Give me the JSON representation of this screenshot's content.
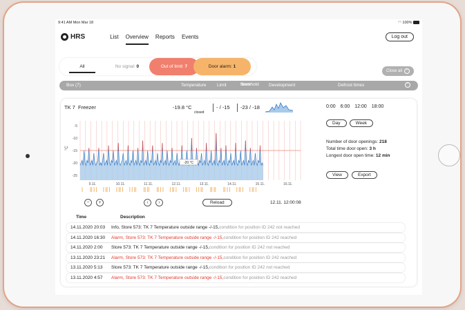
{
  "status_bar": {
    "time": "9:41 AM  Mon Mar 18",
    "battery": "100%"
  },
  "nav": {
    "logo": "HRS",
    "links": [
      "List",
      "Overview",
      "Reports",
      "Events"
    ],
    "active": "Overview",
    "logout": "Log out"
  },
  "filters": {
    "all": "All",
    "no_signal_label": "No signal:",
    "no_signal_count": "0",
    "out_of_limit_label": "Out of limit:",
    "out_of_limit_count": "7",
    "door_alarm_label": "Door alarm:",
    "door_alarm_count": "1"
  },
  "close_all": "Close all",
  "table_header": {
    "box": "Box  (7)",
    "temperature": "Temperature",
    "limit": "Limit",
    "norm1": "Norm",
    "norm2": "threshold",
    "development": "Development",
    "defrost": "Defrost times"
  },
  "card": {
    "id": "TK 7",
    "name": "Freezer",
    "temperature": "-19.8 °C",
    "door_state": "closed",
    "limit": "- / -15",
    "norm": "-23 / -18",
    "defrost_times": [
      "0:00",
      "6:00",
      "12:00",
      "18:00"
    ],
    "day_btn": "Day",
    "week_btn": "Week",
    "stats": [
      {
        "label": "Number of door openings:",
        "value": "218"
      },
      {
        "label": "Total time door open:",
        "value": "3 h"
      },
      {
        "label": "Longest door open time:",
        "value": "12 min"
      }
    ],
    "view_btn": "View",
    "export_btn": "Export",
    "reload_btn": "Reload",
    "chart_timestamp": "12.11.  12:00:08",
    "tooltip": "-20 °C",
    "y_axis_label": "°C"
  },
  "chart_data": {
    "type": "line",
    "y_ticks": [
      "-5",
      "-10",
      "-15",
      "-20",
      "-25"
    ],
    "x_ticks": [
      "9.11.",
      "10.11.",
      "11.11.",
      "12.11.",
      "13.11.",
      "14.11.",
      "15.11.",
      "16.11."
    ],
    "ylim": [
      -27,
      -3
    ],
    "limit_line": -15,
    "series": [
      {
        "values": [
          -21,
          -20,
          -19,
          -21,
          -15,
          -20,
          -21,
          -19,
          -20,
          -14,
          -21,
          -20,
          -19,
          -21,
          -16,
          -20,
          -21,
          -20,
          -19,
          -14,
          -21,
          -20,
          -21,
          -19,
          -16,
          -21,
          -20,
          -19,
          -21,
          -13,
          -20,
          -21,
          -19,
          -20,
          -15,
          -21,
          -20,
          -19,
          -21,
          -12,
          -20,
          -21,
          -20,
          -19,
          -16,
          -21,
          -20,
          -19,
          -21,
          -13,
          -20,
          -21,
          -19,
          -20,
          -15,
          -21,
          -20,
          -19,
          -21,
          -14,
          -20,
          -21,
          -19,
          -20,
          -11,
          -21,
          -20,
          -19,
          -21,
          -15,
          -20,
          -21,
          -19,
          -20,
          -13,
          -21,
          -20,
          -19,
          -21,
          -16,
          -20,
          -21,
          -19,
          -20,
          -12,
          -21,
          -20,
          -19,
          -21,
          -15,
          -20,
          -21,
          -19,
          -20,
          -14,
          -21,
          -20,
          -19,
          -21,
          -16,
          -20,
          -21,
          -19,
          -20,
          -13,
          -21,
          -20,
          -19,
          -21,
          -15,
          -20,
          -21,
          -19,
          -20,
          -10,
          -21,
          -20,
          -19,
          -21,
          -14,
          -20,
          -21,
          -19,
          -20,
          -16,
          -21,
          -20,
          -19,
          -21,
          -12,
          -20,
          -21,
          -19,
          -20,
          -15,
          -21,
          -20,
          -19,
          -21,
          -8,
          -20,
          -21,
          -19,
          -20,
          -14,
          -21,
          -20,
          -19,
          -21,
          -13,
          -20,
          -21,
          -19,
          -20,
          -16,
          -21,
          -20,
          -19,
          -21,
          -12,
          -20,
          -21,
          -19,
          -20,
          -15,
          -21,
          -20,
          -19,
          -21,
          -11,
          -20,
          -21,
          -19,
          -20,
          -14,
          -21,
          -20,
          -19,
          -21,
          -16,
          -20,
          -21,
          -19,
          -20,
          -13,
          -21,
          -20,
          -21
        ]
      }
    ]
  },
  "log": {
    "col_time": "Time",
    "col_desc": "Description",
    "rows": [
      {
        "time": "14.11.2020 20:03",
        "type": "info",
        "prefix": "Info, Store  573: TK 7 Temperature outside range -/-15,",
        "suffix": " condition for position ID 242 not reached"
      },
      {
        "time": "14.11.2020 16:30",
        "type": "alarm",
        "prefix": "Alarm, Store  573: TK 7 Temperature outside range -/-15,",
        "suffix": " condition for position ID 242 reached"
      },
      {
        "time": "14.11.2020 2:00",
        "type": "store",
        "prefix": "Store  573: TK 7 Temperature outside range -/-15,",
        "suffix": " condition for position ID 242 not reached"
      },
      {
        "time": "13.11.2020 23:21",
        "type": "alarm",
        "prefix": "Alarm, Store  573: TK 7 Temperature outside range -/-15,",
        "suffix": " condition for position ID 242 reached"
      },
      {
        "time": "13.11.2020 5:13",
        "type": "store",
        "prefix": "Store  573: TK 7 Temperature outside range -/-15,",
        "suffix": " condition for position ID 242 not reached"
      },
      {
        "time": "13.11.2020 4:57",
        "type": "alarm",
        "prefix": "Alarm, Store  573: TK 7 Temperature outside range -/-15,",
        "suffix": " condition for position ID 242 reached"
      }
    ]
  },
  "colors": {
    "alarm": "#e0392b",
    "line": "#3a7cc4",
    "fill": "#a9cbea",
    "door": "#f0a64a",
    "limit": "#e04a3e"
  }
}
